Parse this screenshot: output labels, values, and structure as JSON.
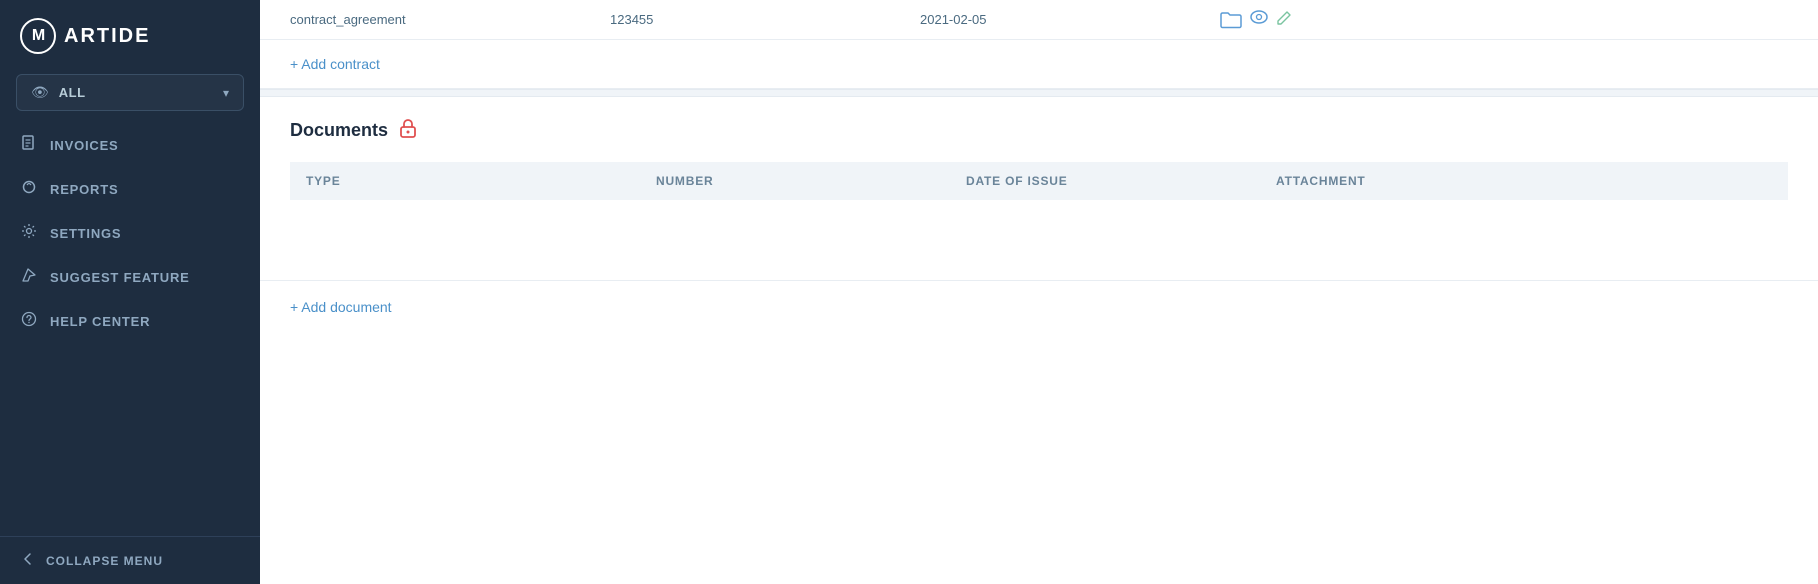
{
  "sidebar": {
    "logo": {
      "letter": "M",
      "text": "ARTIDE"
    },
    "dropdown": {
      "label": "ALL",
      "icon": "👁"
    },
    "nav_items": [
      {
        "id": "invoices",
        "label": "INVOICES",
        "icon": "▦"
      },
      {
        "id": "reports",
        "label": "REPORTS",
        "icon": "📢"
      },
      {
        "id": "settings",
        "label": "SETTINGS",
        "icon": "⚙"
      },
      {
        "id": "suggest",
        "label": "SUGGEST FEATURE",
        "icon": "✈"
      },
      {
        "id": "help",
        "label": "HELP CENTER",
        "icon": "?"
      }
    ],
    "collapse_label": "COLLAPSE MENU"
  },
  "contract_row": {
    "type": "contract_agreement",
    "number": "123455",
    "date": "2021-02-05"
  },
  "add_contract_label": "+ Add contract",
  "documents_section": {
    "title": "Documents",
    "table_headers": [
      "TYPE",
      "NUMBER",
      "DATE OF ISSUE",
      "ATTACHMENT"
    ],
    "rows": []
  },
  "add_document_label": "+ Add document"
}
